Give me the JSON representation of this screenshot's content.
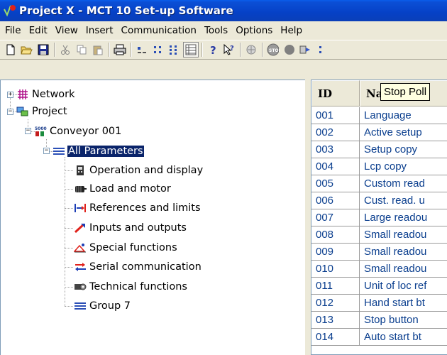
{
  "window": {
    "title": "Project X - MCT 10 Set-up Software"
  },
  "menu": [
    "File",
    "Edit",
    "View",
    "Insert",
    "Communication",
    "Tools",
    "Options",
    "Help"
  ],
  "toolbar": {
    "buttons": [
      "new-icon",
      "open-icon",
      "save-icon",
      "cut-icon",
      "copy-icon",
      "paste-icon",
      "print-icon",
      "large-icons-icon",
      "small-icons-icon",
      "list-icon",
      "details-icon",
      "help-icon",
      "context-help-icon",
      "network-icon",
      "stop-poll-icon",
      "record-icon",
      "read-icon",
      "more-icon"
    ]
  },
  "tooltip": "Stop Poll",
  "tree": {
    "network": "Network",
    "project": "Project",
    "device": "Conveyor 001",
    "all_parameters": "All Parameters",
    "groups": [
      "Operation and display",
      "Load and motor",
      "References and limits",
      "Inputs and outputs",
      "Special functions",
      "Serial communication",
      "Technical functions",
      "Group 7"
    ]
  },
  "grid": {
    "columns": [
      "ID",
      "Na"
    ],
    "rows": [
      {
        "id": "001",
        "name": "Language"
      },
      {
        "id": "002",
        "name": "Active setup"
      },
      {
        "id": "003",
        "name": "Setup copy"
      },
      {
        "id": "004",
        "name": "Lcp copy"
      },
      {
        "id": "005",
        "name": "Custom read"
      },
      {
        "id": "006",
        "name": "Cust. read. u"
      },
      {
        "id": "007",
        "name": "Large readou"
      },
      {
        "id": "008",
        "name": "Small readou"
      },
      {
        "id": "009",
        "name": "Small readou"
      },
      {
        "id": "010",
        "name": "Small readou"
      },
      {
        "id": "011",
        "name": "Unit of loc ref"
      },
      {
        "id": "012",
        "name": "Hand start bt"
      },
      {
        "id": "013",
        "name": "Stop button"
      },
      {
        "id": "014",
        "name": "Auto start bt"
      }
    ]
  },
  "colors": {
    "titlebar": "#0A5EEA",
    "selection": "#0A246A",
    "cell_text": "#0A3E8E",
    "tooltip_bg": "#FFFFE1"
  }
}
